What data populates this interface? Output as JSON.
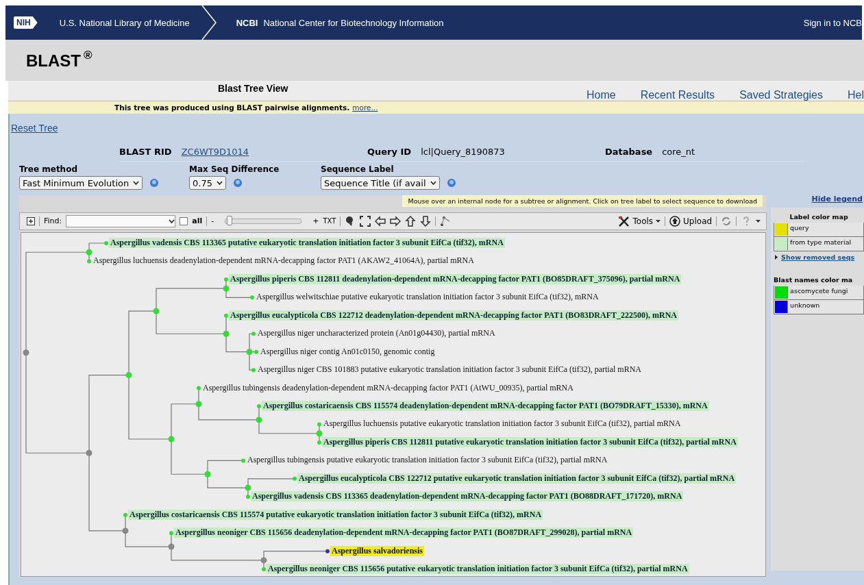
{
  "topbar": {
    "logo": "NIH",
    "library": "U.S. National Library of Medicine",
    "ncbi": "NCBI",
    "center": "National Center for Biotechnology Information",
    "sign_in": "Sign in to NCB"
  },
  "app": {
    "title": "BLAST",
    "mark": "®"
  },
  "view_title": "Blast Tree View",
  "nav": [
    "Home",
    "Recent Results",
    "Saved Strategies",
    "Hel"
  ],
  "notice": {
    "text": "This tree was produced using BLAST pairwise alignments.",
    "link": "more..."
  },
  "reset": "Reset Tree",
  "info": [
    {
      "label": "BLAST RID",
      "value": "ZC6WT9D1014",
      "kind": "link"
    },
    {
      "label": "Query ID",
      "value": "lcl|Query_8190873",
      "kind": "text"
    },
    {
      "label": "Database",
      "value": "core_nt",
      "kind": "text"
    }
  ],
  "options": [
    {
      "label": "Tree method",
      "value": "Fast Minimum Evolution"
    },
    {
      "label": "Max Seq Difference",
      "value": "0.75"
    },
    {
      "label": "Sequence Label",
      "value": "Sequence Title (if avail"
    }
  ],
  "hint": "Mouse over an internal node for a subtree or alignment. Click on tree label to select sequence to download",
  "toolbar": {
    "find_label": "Find:",
    "all_label": "all",
    "all_checked": false,
    "zoom_out": "-",
    "zoom": {
      "level": 0.05
    },
    "zoom_in": "+",
    "txt": "TXT",
    "tools": "Tools",
    "upload": "Upload"
  },
  "legend": {
    "hide": "Hide legend",
    "label_map": {
      "title": "Label color map",
      "items": [
        {
          "label": "query",
          "color": "#e6e000"
        },
        {
          "label": "from type material",
          "color": "#c6ecc6"
        }
      ]
    },
    "removed": "Show removed seqs",
    "blast_map": {
      "title": "Blast names color ma",
      "items": [
        {
          "label": "ascomycete fungi",
          "color": "#00dd00"
        },
        {
          "label": "unknown",
          "color": "#0000dd"
        }
      ]
    }
  },
  "tree": {
    "color": "#888888",
    "children": [
      {
        "color": "#33dd33",
        "children": [
          {
            "label": "Aspergillus vadensis CBS 113365 putative eukaryotic translation initiation factor 3 subunit EifCa (tif32), mRNA",
            "kind": "type_material",
            "color": "#33dd33"
          },
          {
            "label": "Aspergillus luchuensis deadenylation-dependent mRNA-decapping factor PAT1 (AKAW2_41064A), partial mRNA",
            "kind": "plain",
            "color": "#33dd33"
          }
        ]
      },
      {
        "color": "#888888",
        "children": [
          {
            "color": "#33dd33",
            "children": [
              {
                "color": "#33dd33",
                "children": [
                  {
                    "color": "#33dd33",
                    "children": [
                      {
                        "label": "Aspergillus piperis CBS 112811 deadenylation-dependent mRNA-decapping factor PAT1 (BO85DRAFT_375096), partial mRNA",
                        "kind": "type_material",
                        "color": "#33dd33"
                      },
                      {
                        "label": "Aspergillus welwitschiae putative eukaryotic translation initiation factor 3 subunit EifCa (tif32), mRNA",
                        "kind": "plain",
                        "color": "#33dd33"
                      }
                    ]
                  },
                  {
                    "color": "#33dd33",
                    "children": [
                      {
                        "label": "Aspergillus eucalypticola CBS 122712 deadenylation-dependent mRNA-decapping factor PAT1 (BO83DRAFT_222500), mRNA",
                        "kind": "type_material",
                        "color": "#33dd33"
                      },
                      {
                        "color": "#33dd33",
                        "children": [
                          {
                            "label": "Aspergillus niger uncharacterized protein (An01g04430), partial mRNA",
                            "kind": "plain",
                            "color": "#33dd33"
                          },
                          {
                            "label": "Aspergillus niger contig An01c0150, genomic contig",
                            "kind": "plain",
                            "color": "#33dd33"
                          },
                          {
                            "label": "Aspergillus niger CBS 101883 putative eukaryotic translation initiation factor 3 subunit EifCa (tif32), partial mRNA",
                            "kind": "plain",
                            "color": "#33dd33"
                          }
                        ]
                      }
                    ]
                  }
                ]
              },
              {
                "color": "#33dd33",
                "children": [
                  {
                    "color": "#33dd33",
                    "children": [
                      {
                        "label": "Aspergillus tubingensis deadenylation-dependent mRNA-decapping factor PAT1 (AtWU_00935), partial mRNA",
                        "kind": "plain",
                        "color": "#33dd33"
                      },
                      {
                        "color": "#33dd33",
                        "children": [
                          {
                            "label": "Aspergillus costaricaensis CBS 115574 deadenylation-dependent mRNA-decapping factor PAT1 (BO79DRAFT_15330), mRNA",
                            "kind": "type_material",
                            "color": "#33dd33"
                          },
                          {
                            "color": "#33dd33",
                            "children": [
                              {
                                "label": "Aspergillus luchuensis putative eukaryotic translation initiation factor 3 subunit EifCa (tif32), partial mRNA",
                                "kind": "plain",
                                "color": "#33dd33"
                              },
                              {
                                "label": "Aspergillus piperis CBS 112811 putative eukaryotic translation initiation factor 3 subunit EifCa (tif32), partial mRNA",
                                "kind": "type_material",
                                "color": "#33dd33"
                              }
                            ]
                          }
                        ]
                      }
                    ]
                  },
                  {
                    "color": "#33dd33",
                    "children": [
                      {
                        "label": "Aspergillus tubingensis putative eukaryotic translation initiation factor 3 subunit EifCa (tif32), partial mRNA",
                        "kind": "plain",
                        "color": "#33dd33"
                      },
                      {
                        "color": "#33dd33",
                        "children": [
                          {
                            "label": "Aspergillus eucalypticola CBS 122712 putative eukaryotic translation initiation factor 3 subunit EifCa (tif32), partial mRNA",
                            "kind": "type_material",
                            "color": "#33dd33"
                          },
                          {
                            "label": "Aspergillus vadensis CBS 113365 deadenylation-dependent mRNA-decapping factor PAT1 (BO88DRAFT_171720), mRNA",
                            "kind": "type_material",
                            "color": "#33dd33"
                          }
                        ]
                      }
                    ]
                  }
                ]
              }
            ]
          },
          {
            "color": "#888888",
            "children": [
              {
                "label": "Aspergillus costaricaensis CBS 115574 putative eukaryotic translation initiation factor 3 subunit EifCa (tif32), mRNA",
                "kind": "type_material",
                "color": "#33dd33"
              },
              {
                "color": "#888888",
                "children": [
                  {
                    "label": "Aspergillus neoniger CBS 115656 deadenylation-dependent mRNA-decapping factor PAT1 (BO87DRAFT_299028), partial mRNA",
                    "kind": "type_material",
                    "color": "#33dd33"
                  },
                  {
                    "color": "#888888",
                    "children": [
                      {
                        "label": "Aspergillus salvadoriensis",
                        "kind": "query",
                        "color": "#3333aa"
                      },
                      {
                        "label": "Aspergillus neoniger CBS 115656 putative eukaryotic translation initiation factor 3 subunit EifCa (tif32), partial mRNA",
                        "kind": "type_material",
                        "color": "#33dd33"
                      }
                    ]
                  }
                ]
              }
            ]
          }
        ]
      }
    ]
  }
}
